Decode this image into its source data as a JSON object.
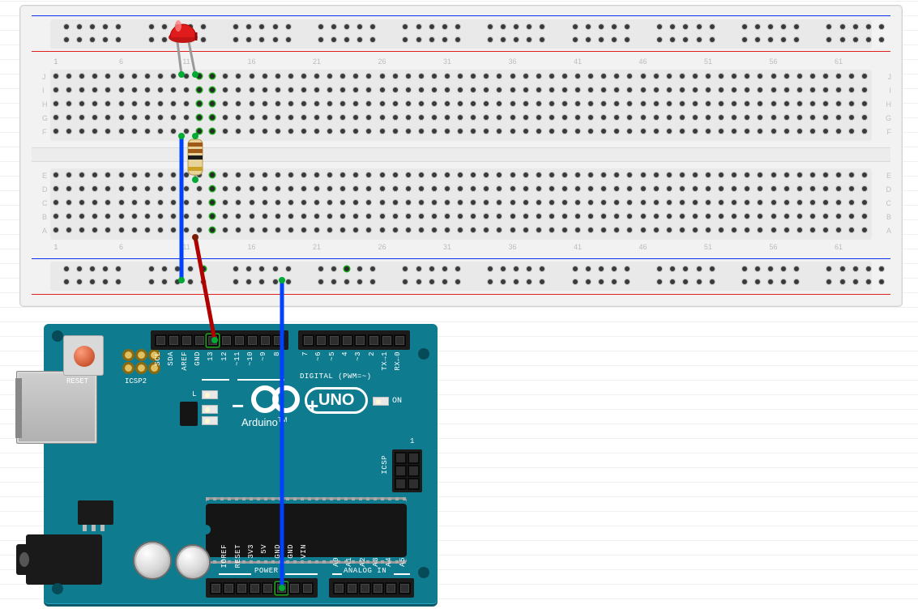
{
  "components": {
    "board": "Arduino UNO",
    "brand": "Arduino",
    "reset_label": "RESET",
    "icsp2_label": "ICSP2",
    "icsp_label": "ICSP",
    "digital_label": "DIGITAL (PWM=~)",
    "power_label": "POWER",
    "analog_label": "ANALOG IN",
    "on_label": "ON",
    "l_label": "L",
    "tx_label": "TX",
    "rx_label": "RX",
    "uno_text": "UNO",
    "tm": "TM"
  },
  "pins": {
    "top_left": [
      "SCL",
      "SDA",
      "AREF",
      "GND",
      "13",
      "12",
      "~11",
      "~10",
      "~9",
      "8"
    ],
    "top_right": [
      "7",
      "~6",
      "~5",
      "4",
      "~3",
      "2",
      "TX→1",
      "RX←0"
    ],
    "power": [
      "",
      "IOREF",
      "RESET",
      "3V3",
      "5V",
      "GND",
      "GND",
      "VIN"
    ],
    "analog": [
      "A0",
      "A1",
      "A2",
      "A3",
      "A4",
      "A5"
    ],
    "icsp_marker": "1"
  },
  "breadboard": {
    "rows_top": [
      "J",
      "I",
      "H",
      "G",
      "F"
    ],
    "rows_bot": [
      "E",
      "D",
      "C",
      "B",
      "A"
    ],
    "col_start": 1,
    "col_end": 63,
    "col_step": 5
  },
  "led": {
    "color": "#e01b1b"
  },
  "resistor": {
    "bands": [
      "#a05a1a",
      "#a05a1a",
      "#1a1a1a",
      "#c9a227"
    ]
  },
  "wires": [
    {
      "name": "pin13-to-resistor",
      "color": "#b00000"
    },
    {
      "name": "gnd-to-bus",
      "color": "#0040ff"
    },
    {
      "name": "bus-to-led",
      "color": "#0040ff"
    }
  ]
}
